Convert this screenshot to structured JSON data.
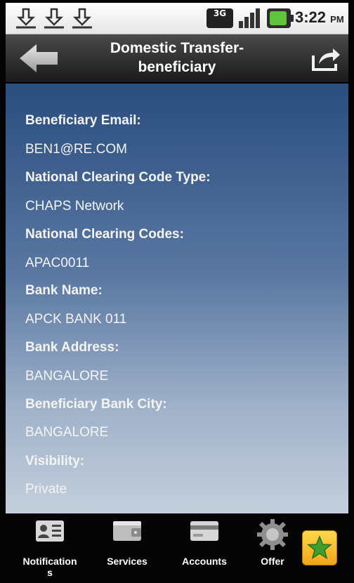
{
  "status_bar": {
    "network": "3G",
    "time": "3:22",
    "ampm": "PM"
  },
  "header": {
    "title_line1": "Domestic Transfer-",
    "title_line2": "beneficiary"
  },
  "details": [
    {
      "label": "Beneficiary Email:",
      "value": "BEN1@RE.COM"
    },
    {
      "label": "National Clearing Code Type:",
      "value": "CHAPS Network"
    },
    {
      "label": "National Clearing Codes:",
      "value": "APAC0011"
    },
    {
      "label": "Bank Name:",
      "value": "APCK BANK 011"
    },
    {
      "label": "Bank Address:",
      "value": "BANGALORE"
    },
    {
      "label": "Beneficiary Bank City:",
      "value": "BANGALORE"
    },
    {
      "label": "Visibility:",
      "value": "Private"
    }
  ],
  "bottom_nav": {
    "items": [
      {
        "label_line1": "Notification",
        "label_line2": "s",
        "icon": "contact-card-icon"
      },
      {
        "label_line1": "Services",
        "label_line2": "",
        "icon": "wallet-icon"
      },
      {
        "label_line1": "Accounts",
        "label_line2": "",
        "icon": "card-icon"
      },
      {
        "label_line1": "Offer",
        "label_line2": "",
        "icon": "gear-icon"
      }
    ],
    "favorite_icon": "star-icon"
  },
  "colors": {
    "content_top": "#294d7e",
    "content_bottom": "#c4cfdc",
    "battery": "#5fc43a",
    "favorite": "#f2a51a"
  }
}
